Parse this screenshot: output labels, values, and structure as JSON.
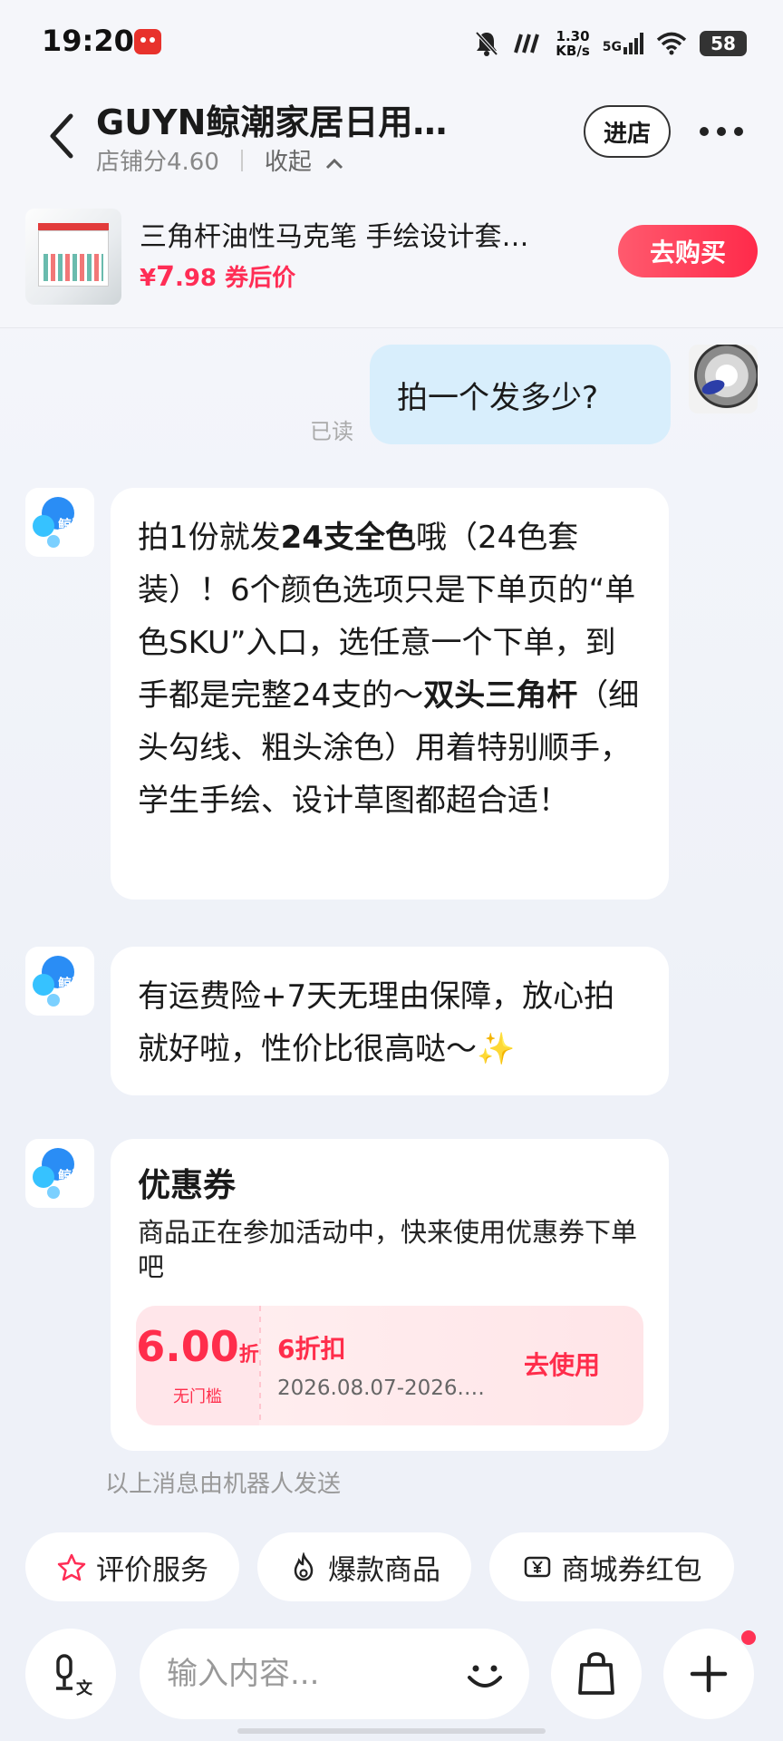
{
  "status_bar": {
    "time": "19:20",
    "net_speed": "1.30",
    "net_speed_unit": "KB/s",
    "network": "5G",
    "battery": "58"
  },
  "header": {
    "shop_name": "GUYN鲸潮家居日用…",
    "shop_score": "店铺分4.60",
    "collapse_label": "收起",
    "enter_shop_label": "进店"
  },
  "product": {
    "title": "三角杆油性马克笔 手绘设计套…",
    "price_symbol": "¥",
    "price_int": "7",
    "price_dec": ".98",
    "price_suffix": "券后价",
    "buy_label": "去购买"
  },
  "messages": {
    "user_message": "拍一个发多少?",
    "read_status": "已读",
    "bot_msg1": {
      "p1": "拍1份就发",
      "b1": "24支全色",
      "p2": "哦（24色套装）！6个颜色选项只是下单页的“单色SKU”入口，选任意一个下单，到手都是完整24支的～",
      "b2": "双头三角杆",
      "p3": "（细头勾线、粗头涂色）用着特别顺手，学生手绘、设计草图都超合适！"
    },
    "bot_msg2": "有运费险+7天无理由保障，放心拍就好啦，性价比很高哒～✨",
    "bot_logo_text": "鲸潮",
    "coupon": {
      "title": "优惠券",
      "description": "商品正在参加活动中，快来使用优惠券下单吧",
      "amount": "6.00",
      "amount_unit": "折",
      "threshold": "无门槛",
      "name": "6折扣",
      "validity": "2026.08.07-2026.…",
      "use_label": "去使用"
    },
    "bot_note": "以上消息由机器人发送"
  },
  "quick_actions": [
    {
      "label": "评价服务",
      "icon": "star-icon"
    },
    {
      "label": "爆款商品",
      "icon": "flame-icon"
    },
    {
      "label": "商城券红包",
      "icon": "yen-coupon-icon"
    }
  ],
  "input": {
    "placeholder": "输入内容..."
  },
  "colors": {
    "accent": "#ff2d55",
    "user_bubble": "#d8eefc",
    "background": "#f5f6fa"
  }
}
